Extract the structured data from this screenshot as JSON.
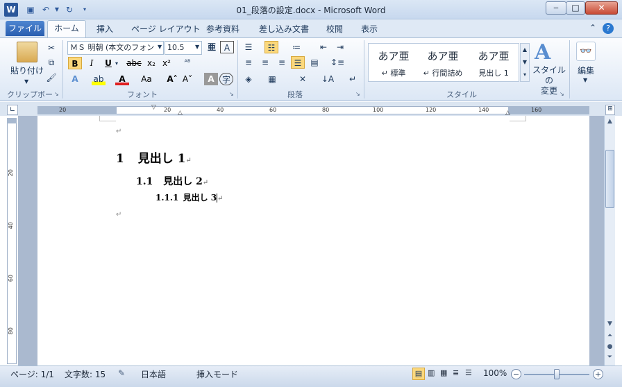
{
  "window": {
    "title": "01_段落の設定.docx - Microsoft Word",
    "minimize": "‒",
    "maximize": "□",
    "close": "✕"
  },
  "quick_access": {
    "save_icon": "save-icon",
    "undo_icon": "undo-icon",
    "redo_icon": "redo-icon"
  },
  "tabs": {
    "file": "ファイル",
    "home": "ホーム",
    "insert": "挿入",
    "layout": "ページ レイアウト",
    "references": "参考資料",
    "mailings": "差し込み文書",
    "review": "校閲",
    "view": "表示"
  },
  "ribbon": {
    "clipboard": {
      "label": "クリップボード",
      "paste": "貼り付け"
    },
    "font": {
      "label": "フォント",
      "font_name": "ＭＳ 明朝 (本文のフォン",
      "font_size": "10.5",
      "bold": "B",
      "italic": "I",
      "underline": "U",
      "strike": "abc",
      "subscript": "x₂",
      "superscript": "x²",
      "change_case": "Aa"
    },
    "paragraph": {
      "label": "段落"
    },
    "styles": {
      "label": "スタイル",
      "items": [
        {
          "sample": "あア亜",
          "name": "↵ 標準"
        },
        {
          "sample": "あア亜",
          "name": "↵ 行間詰め"
        },
        {
          "sample": "あア亜",
          "name": "見出し 1"
        }
      ],
      "change_styles": "スタイルの\n変更"
    },
    "editing": {
      "label": "編集"
    }
  },
  "ruler": {
    "h_ticks": [
      "20",
      "20",
      "40",
      "60",
      "80",
      "100",
      "120",
      "140",
      "160"
    ],
    "v_ticks": [
      "20",
      "40",
      "60",
      "80"
    ]
  },
  "document": {
    "empty_para_1": "↵",
    "h1_number": "1",
    "h1_text": "見出し 1",
    "h2_number": "1.1",
    "h2_text": "見出し 2",
    "h3_number": "1.1.1",
    "h3_text": "見出し 3",
    "empty_para_2": "↵",
    "para_mark": "↵"
  },
  "status": {
    "page": "ページ: 1/1",
    "words": "文字数: 15",
    "language": "日本語",
    "mode": "挿入モード",
    "zoom": "100%"
  }
}
